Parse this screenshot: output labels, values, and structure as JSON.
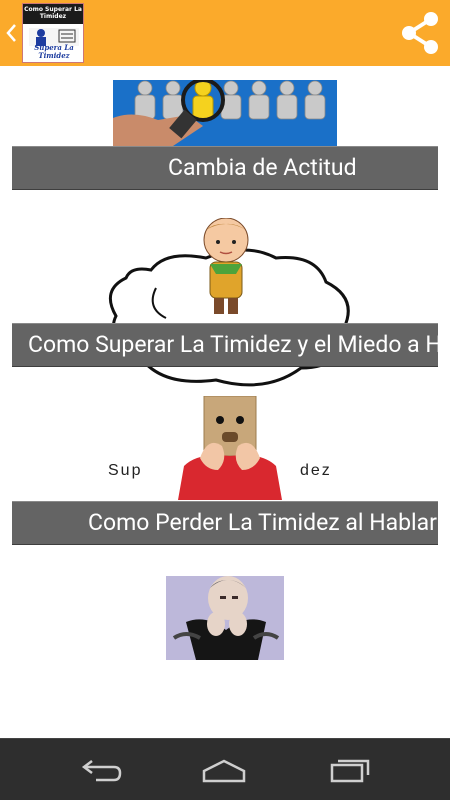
{
  "app": {
    "icon_title": "Como Superar La Timidez",
    "icon_tagline": "Supera La Timidez"
  },
  "items": [
    {
      "label": "Cambia de Actitud"
    },
    {
      "label": "Como Superar La Timidez y el Miedo a Hablar"
    },
    {
      "label": "Como Perder La Timidez al Hablar"
    }
  ],
  "illustration": {
    "text_left": "Sup",
    "text_right": "dez"
  },
  "colors": {
    "actionbar": "#fbaa2b",
    "button": "#646464",
    "navbar": "#2e2e2e"
  }
}
